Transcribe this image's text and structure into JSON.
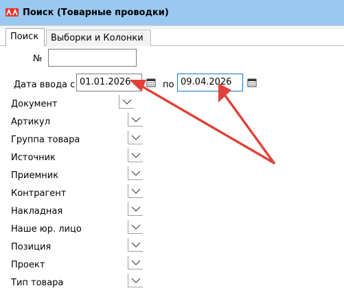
{
  "window": {
    "title": "Поиск (Товарные проводки)"
  },
  "tabs": [
    {
      "label": "Поиск",
      "active": true
    },
    {
      "label": "Выборки и Колонки",
      "active": false
    }
  ],
  "search": {
    "number_label": "№",
    "number_value": "",
    "date_from_label": "Дата ввода с",
    "date_from_value": "01.01.2026",
    "date_to_label": "по",
    "date_to_value": "09.04.2026",
    "fields": [
      "Документ",
      "Артикул",
      "Группа товара",
      "Источник",
      "Приемник",
      "Контрагент",
      "Накладная",
      "Наше юр. лицо",
      "Позиция",
      "Проект",
      "Тип товара"
    ]
  },
  "colors": {
    "title_bar": "#99c9f0",
    "arrow": "#e0413a",
    "logo": "#e4332c"
  },
  "icons": [
    "app-logo-icon",
    "calendar-icon",
    "chevron-down-icon"
  ]
}
